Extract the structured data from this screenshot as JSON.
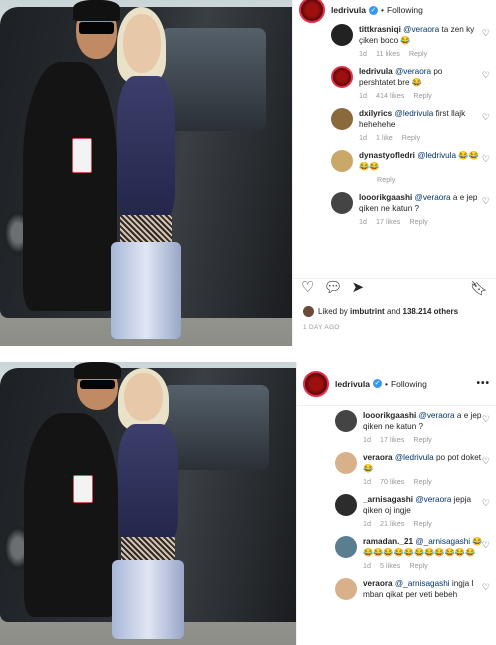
{
  "top": {
    "header": {
      "username": "ledrivula",
      "separator": "•",
      "follow": "Following"
    },
    "comments": [
      {
        "avatar": "avatar-tittkrasniqi",
        "user": "tittkrasniqi",
        "mention": "@veraora",
        "text": "ta zen ky çiken boco 😂",
        "time": "1d",
        "likes": "11 likes",
        "reply": "Reply"
      },
      {
        "avatar": "avatar-ledrivula",
        "user": "ledrivula",
        "mention": "@veraora",
        "text": "po pershtatet bre 😂",
        "time": "1d",
        "likes": "414 likes",
        "reply": "Reply"
      },
      {
        "avatar": "avatar-dxilyrics",
        "user": "dxilyrics",
        "mention": "@ledrivula",
        "text": "first llajk hehehehe",
        "time": "1d",
        "likes": "1 like",
        "reply": "Reply"
      },
      {
        "avatar": "avatar-dynastyofledri",
        "user": "dynastyofledri",
        "mention": "@ledrivula",
        "text": "😂😂😂😂",
        "time": "",
        "likes": "",
        "reply": "Reply"
      },
      {
        "avatar": "avatar-looorikgaashi",
        "user": "looorikgaashi",
        "mention": "@veraora",
        "text": "a e jep qiken ne katun ?",
        "time": "1d",
        "likes": "17 likes",
        "reply": "Reply"
      }
    ],
    "liked_by": {
      "prefix": "Liked by",
      "user": "imbutrint",
      "connector": "and",
      "count": "138.214 others"
    },
    "ago": "1 DAY AGO"
  },
  "bottom": {
    "header": {
      "username": "ledrivula",
      "separator": "•",
      "follow": "Following"
    },
    "comments": [
      {
        "avatar": "avatar-looorikgaashi",
        "user": "looorikgaashi",
        "mention": "@veraora",
        "text": "a e jep qiken ne katun ?",
        "time": "1d",
        "likes": "17 likes",
        "reply": "Reply"
      },
      {
        "avatar": "avatar-veraora",
        "user": "veraora",
        "mention": "@ledrivula",
        "text": "po pot doket 😂",
        "time": "1d",
        "likes": "70 likes",
        "reply": "Reply"
      },
      {
        "avatar": "avatar-arnisagashi",
        "user": "_arnisagashi",
        "mention": "@veraora",
        "text": "jepja qiken oj ingje",
        "time": "1d",
        "likes": "21 likes",
        "reply": "Reply"
      },
      {
        "avatar": "avatar-ramadan21",
        "user": "ramadan._21",
        "mention": "@_arnisagashi",
        "text": "😂😂😂😂😂😂😂😂😂😂😂😂",
        "time": "1d",
        "likes": "5 likes",
        "reply": "Reply"
      },
      {
        "avatar": "avatar-veraora-2",
        "user": "veraora",
        "mention": "@_arnisagashi",
        "text": "ingja I mban qikat per veti bebeh",
        "time": "",
        "likes": "",
        "reply": ""
      }
    ]
  },
  "colors": {
    "accent": "#3897f0",
    "ring": "#e2304a",
    "muted": "#999999"
  }
}
